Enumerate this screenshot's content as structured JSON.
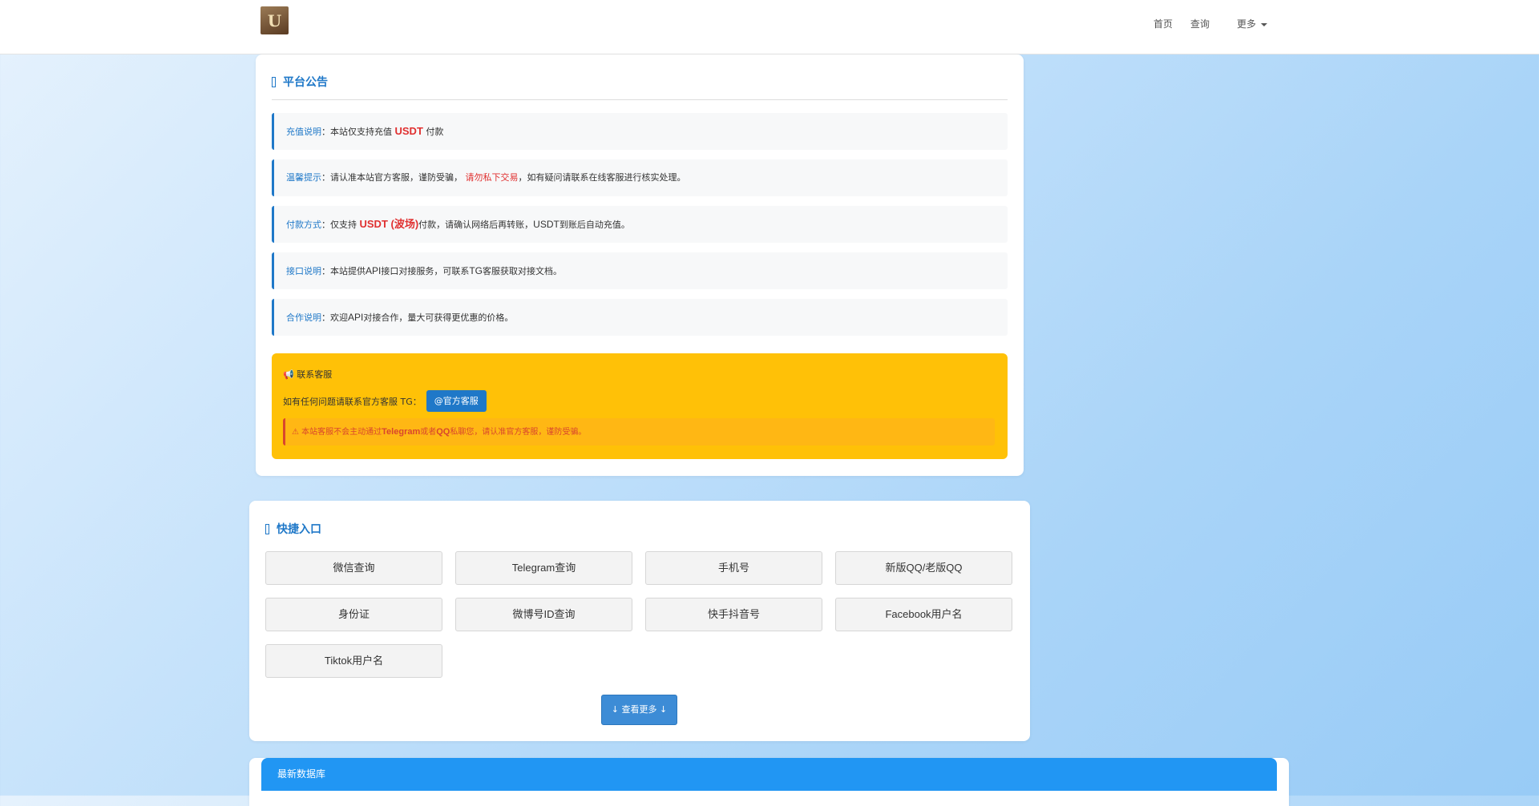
{
  "nav": {
    "logo_text": "U",
    "links": [
      {
        "label": "首页"
      },
      {
        "label": "查询"
      },
      {
        "label": "更多"
      }
    ]
  },
  "notice": {
    "title": "平台公告",
    "items": [
      {
        "lead": "充值说明",
        "text1": "：本站仅支持充值",
        "hl": "USDT",
        "text2": " 付款"
      },
      {
        "lead": "温馨提示",
        "text1": "：请认准本站官方客服，谨防受骗，",
        "warn": "请勿私下交易",
        "text2": "，如有疑问请联系在线客服进行核实处理。"
      },
      {
        "lead": "付款方式",
        "text1": "：仅支持",
        "hl": "USDT (波场)",
        "text2": "付款，请确认网络后再转账，",
        "latin": "USDT",
        "text3": "到账后自动充值。"
      },
      {
        "lead": "接口说明",
        "text1": "：本站提供",
        "latin": "API",
        "text2": "接口对接服务，可联系",
        "latin2": "TG",
        "text3": "客服获取对接文档。"
      },
      {
        "lead": "合作说明",
        "text1": "：欢迎",
        "latin": "API",
        "text2": "对接合作，量大可获得更优惠的价格。"
      }
    ]
  },
  "contact": {
    "title": "📢 联系客服",
    "line": "如有任何问题请联系官方客服 TG：",
    "tg_button": "@官方客服",
    "alert_prefix": "⚠ 本站客服不会主动通过",
    "alert_telegram": "Telegram",
    "alert_mid": "或者",
    "alert_qq": "QQ",
    "alert_suffix": "私聊您，请认准官方客服，谨防受骗。"
  },
  "links": {
    "title": "快捷入口",
    "buttons": [
      {
        "label": "微信查询"
      },
      {
        "label": "Telegram查询"
      },
      {
        "label": "手机号"
      },
      {
        "label": "新版QQ/老版QQ"
      },
      {
        "label": "身份证"
      },
      {
        "label": "微博号ID查询"
      },
      {
        "label": "快手抖音号"
      },
      {
        "label": "Facebook用户名"
      },
      {
        "label": "Tiktok用户名"
      }
    ],
    "more_button": "↓ 查看更多 ↓"
  },
  "bottom": {
    "header": "最新数据库"
  }
}
